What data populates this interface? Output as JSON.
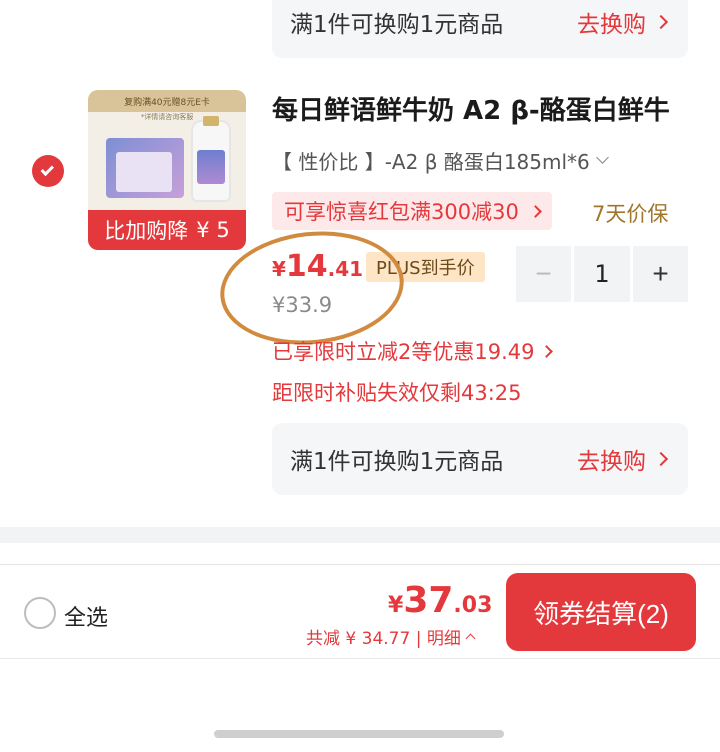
{
  "exchange_top": {
    "label": "满1件可换购1元商品",
    "action": "去换购"
  },
  "product": {
    "thumb_banner": "复购满40元赠8元E卡",
    "thumb_subtext": "*详情请咨询客服",
    "thumb_promo_label": "比加购降",
    "thumb_promo_amount": "¥ 5",
    "title": "每日鲜语鲜牛奶 A2 β-酪蛋白鲜牛",
    "spec": "【 性价比 】-A2 β 酪蛋白185ml*6",
    "coupon": "可享惊喜红包满300减30",
    "price_protect": "7天价保",
    "price_currency": "¥",
    "price_int": "14",
    "price_dec": ".41",
    "plus_tag": "PLUS到手价",
    "old_price": "¥33.9",
    "quantity": "1",
    "discount_line": "已享限时立减2等优惠19.49",
    "subsidy_line": "距限时补贴失效仅剩43:25"
  },
  "exchange_bottom": {
    "label": "满1件可换购1元商品",
    "action": "去换购"
  },
  "footer": {
    "select_all": "全选",
    "total_currency": "¥",
    "total_int": "37",
    "total_dec": ".03",
    "saving": "共减 ¥ 34.77 | 明细",
    "checkout": "领券结算(2)"
  },
  "colors": {
    "accent": "#e4393c",
    "annotation": "#d18b3f",
    "price_protect": "#a0762c"
  }
}
